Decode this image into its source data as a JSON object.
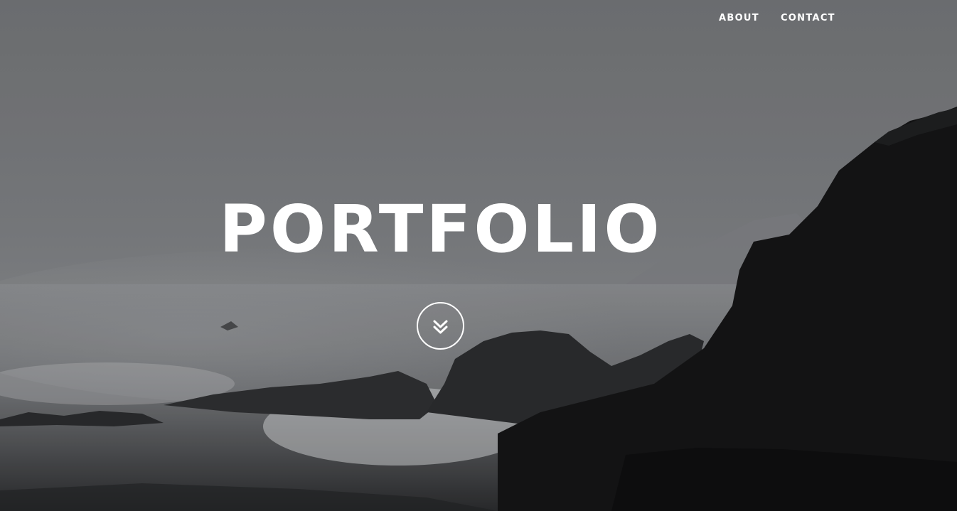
{
  "nav": {
    "items": [
      {
        "label": "ABOUT"
      },
      {
        "label": "CONTACT"
      }
    ]
  },
  "hero": {
    "title": "PORTFOLIO",
    "scroll_icon": "double-chevron-down-icon",
    "background": "grayscale coastal cliffs with crashing waves in fog"
  },
  "colors": {
    "text": "#ffffff",
    "sky": "#7a7c7f",
    "cliff": "#141414"
  }
}
